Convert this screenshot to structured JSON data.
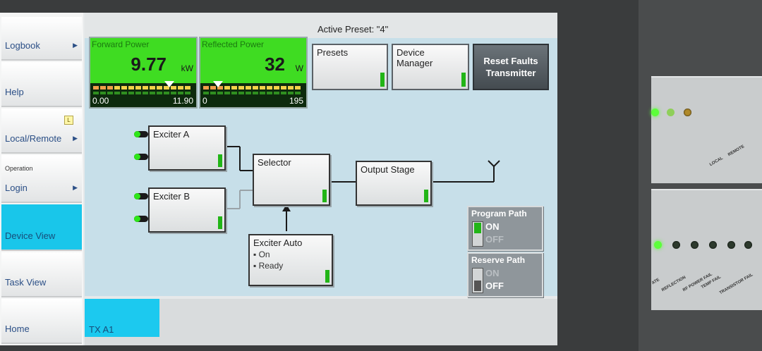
{
  "sidebar": {
    "logbook": "Logbook",
    "help": "Help",
    "local_remote": "Local/Remote",
    "local_badge": "L",
    "operation_sub": "Operation",
    "login": "Login",
    "device_view": "Device View",
    "task_view": "Task View",
    "home": "Home",
    "arrow": "▶"
  },
  "header": {
    "active_preset": "Active Preset: \"4\""
  },
  "forward_power": {
    "label": "Forward Power",
    "value": "9.77",
    "unit": "kW",
    "min": "0.00",
    "max": "11.90",
    "level": 0.82
  },
  "reflected_power": {
    "label": "Reflected Power",
    "value": "32",
    "unit": "W",
    "min": "0",
    "max": "195",
    "level": 0.16
  },
  "buttons": {
    "presets": "Presets",
    "device_manager_1": "Device",
    "device_manager_2": "Manager",
    "reset_1": "Reset Faults",
    "reset_2": "Transmitter"
  },
  "diagram": {
    "exciter_a": "Exciter A",
    "exciter_b": "Exciter B",
    "selector": "Selector",
    "output_stage": "Output Stage",
    "exciter_auto": "Exciter Auto",
    "auto_on": "▪ On",
    "auto_ready": "▪ Ready"
  },
  "program_path": {
    "title": "Program Path",
    "on": "ON",
    "off": "OFF",
    "state": "ON"
  },
  "reserve_path": {
    "title": "Reserve Path",
    "on": "ON",
    "off": "OFF",
    "state": "OFF"
  },
  "bottom": {
    "tab": "TX A1"
  },
  "rack": {
    "labels_top": [
      "LOCAL",
      "REMOTE"
    ],
    "labels_bottom": [
      "ATE",
      "REFLECTION",
      "RF POWER FAIL",
      "TEMP FAIL",
      "TRANSISTOR FAIL"
    ]
  },
  "colors": {
    "accent": "#19c6ea",
    "meter_bg": "#3fdc22",
    "status_green": "#22b517",
    "panel": "#c7dfe9"
  }
}
